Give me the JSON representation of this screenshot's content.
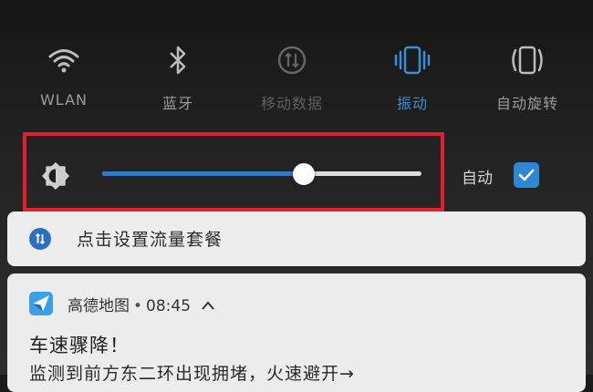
{
  "quick_settings": {
    "toggles": [
      {
        "label": "WLAN",
        "state": "on",
        "icon": "wifi-icon"
      },
      {
        "label": "蓝牙",
        "state": "on",
        "icon": "bluetooth-icon"
      },
      {
        "label": "移动数据",
        "state": "off",
        "icon": "mobile-data-icon"
      },
      {
        "label": "振动",
        "state": "active",
        "icon": "vibrate-icon"
      },
      {
        "label": "自动旋转",
        "state": "on",
        "icon": "auto-rotate-icon"
      }
    ]
  },
  "brightness": {
    "icon": "brightness-icon",
    "level": 0.63,
    "auto_label": "自动",
    "auto_checked": true,
    "highlight_color": "#e3212c"
  },
  "notifications": {
    "data_plan": {
      "icon": "mobile-data-icon",
      "text": "点击设置流量套餐"
    },
    "amap": {
      "app_name": "高德地图",
      "separator": "•",
      "time": "08:45",
      "title": "车速骤降！",
      "body": "监测到前方东二环出现拥堵，火速避开→"
    }
  },
  "colors": {
    "accent": "#3d8cd6",
    "slider_fill": "#2f7cc6",
    "checkbox": "#2f86d6"
  }
}
